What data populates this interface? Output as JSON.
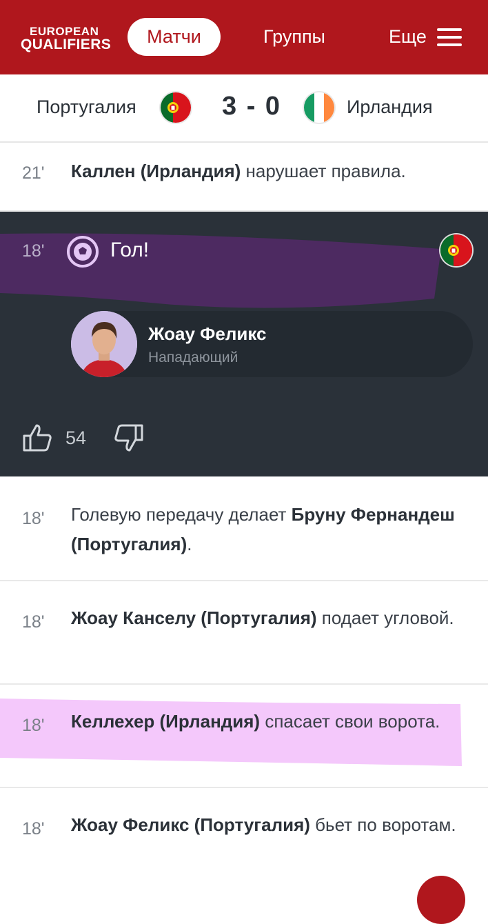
{
  "header": {
    "logo_line1": "EUROPEAN",
    "logo_line2": "QUALIFIERS",
    "nav": {
      "active": "Матчи",
      "groups": "Группы",
      "more": "Еще"
    }
  },
  "match": {
    "home_team": "Португалия",
    "away_team": "Ирландия",
    "score": "3 - 0"
  },
  "events": [
    {
      "minute": "21'",
      "bold": "Каллен (Ирландия)",
      "text": " нарушает правила."
    }
  ],
  "goal": {
    "minute": "18'",
    "title": "Гол!",
    "player_name": "Жоау Феликс",
    "player_role": "Нападающий",
    "likes": "54"
  },
  "events_after": [
    {
      "minute": "18'",
      "pre": "Голевую передачу делает ",
      "bold": "Бруну Фернандеш (Португалия)",
      "post": "."
    },
    {
      "minute": "18'",
      "pre": "",
      "bold": "Жоау Канселу (Португалия)",
      "post": " подает угловой."
    },
    {
      "minute": "18'",
      "pre": "",
      "bold": "Келлехер (Ирландия)",
      "post": " спасает свои ворота."
    },
    {
      "minute": "18'",
      "pre": "",
      "bold": "Жоау Феликс (Португалия)",
      "post": " бьет по воротам."
    }
  ],
  "colors": {
    "brand_red": "#b0171d",
    "dark_card": "#2a3139",
    "purple_highlight": "#4f2a63",
    "pink_highlight": "#f4c8fb"
  }
}
